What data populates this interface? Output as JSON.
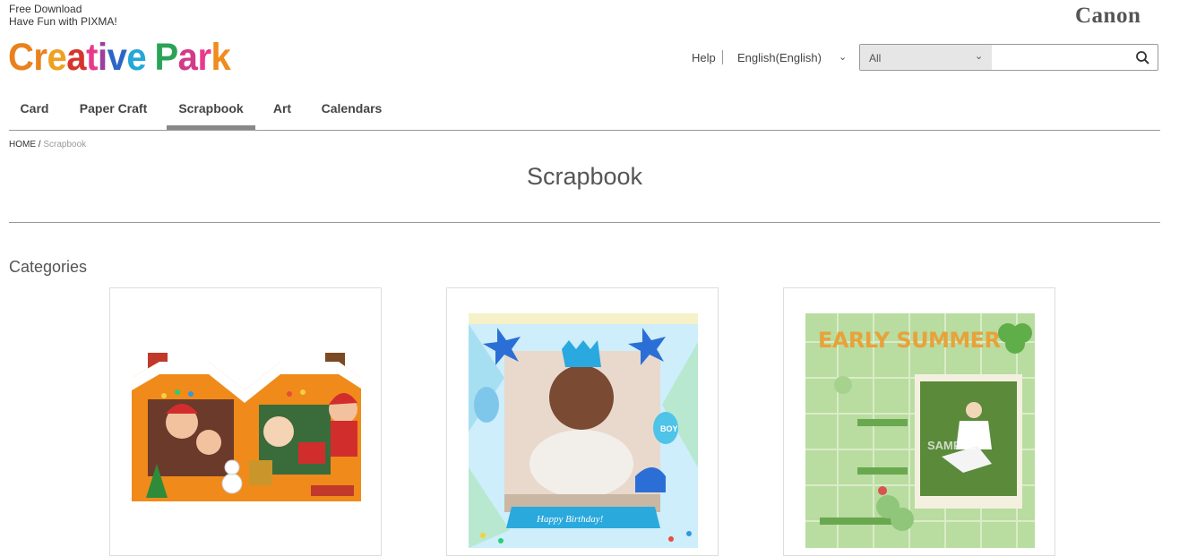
{
  "header": {
    "tagline_line1": "Free Download",
    "tagline_line2": "Have Fun with PIXMA!",
    "logo_text": "Creative Park",
    "logo_colors": [
      "#e8821e",
      "#e8821e",
      "#f0a020",
      "#d7342c",
      "#e83a8c",
      "#9b3fa0",
      "#2b66c7",
      "#23a7d7",
      "#2aa356",
      "#d23a8a",
      "#e83a8c",
      "#f08c1e",
      "#7ab32e"
    ],
    "brand": "Canon",
    "help_label": "Help",
    "language_label": "English(English)",
    "search": {
      "scope_label": "All",
      "query": ""
    }
  },
  "nav": {
    "tabs": [
      {
        "label": "Card",
        "active": false
      },
      {
        "label": "Paper Craft",
        "active": false
      },
      {
        "label": "Scrapbook",
        "active": true
      },
      {
        "label": "Art",
        "active": false
      },
      {
        "label": "Calendars",
        "active": false
      }
    ]
  },
  "breadcrumb": {
    "home": "HOME",
    "separator": "/",
    "current": "Scrapbook"
  },
  "page": {
    "title": "Scrapbook",
    "categories_heading": "Categories"
  },
  "categories": [
    {
      "image": "christmas-house-scrapbook"
    },
    {
      "image": "happy-birthday-scrapbook",
      "banner_text": "Happy Birthday!",
      "balloon_text": "BOY"
    },
    {
      "image": "early-summer-scrapbook",
      "heading_text": "EARLY SUMMER",
      "watermark": "SAMPLE"
    }
  ],
  "icons": {
    "search": "search-icon",
    "lang_chevron": "chevron-down-icon",
    "scope_chevron": "chevron-down-icon"
  }
}
